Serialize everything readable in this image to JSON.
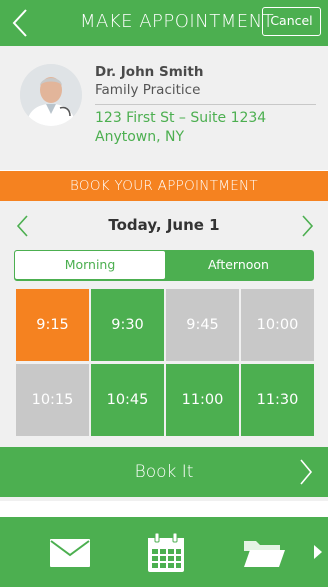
{
  "header": {
    "title": "MAKE APPOINTMENT",
    "cancel_label": "Cancel",
    "back_icon": "chevron-left-icon"
  },
  "doctor": {
    "name": "Dr. John Smith",
    "specialty": "Family Pracitice",
    "address_line1": "123 First St – Suite 1234",
    "address_line2": "Anytown, NY"
  },
  "booking": {
    "banner": "BOOK YOUR APPOINTMENT",
    "date_label": "Today, June 1",
    "segments": {
      "morning": "Morning",
      "afternoon": "Afternoon",
      "selected": "Morning"
    },
    "slots": [
      {
        "time": "9:15",
        "state": "selected"
      },
      {
        "time": "9:30",
        "state": "available"
      },
      {
        "time": "9:45",
        "state": "unavailable"
      },
      {
        "time": "10:00",
        "state": "unavailable"
      },
      {
        "time": "10:15",
        "state": "unavailable"
      },
      {
        "time": "10:45",
        "state": "available"
      },
      {
        "time": "11:00",
        "state": "available"
      },
      {
        "time": "11:30",
        "state": "available"
      }
    ],
    "book_label": "Book It"
  },
  "tabbar": {
    "items": [
      "mail-icon",
      "calendar-icon",
      "folder-icon",
      "more-arrow-icon"
    ],
    "active": "calendar-icon"
  },
  "colors": {
    "green": "#4caf50",
    "orange": "#f58220",
    "gray_slot": "#c8c8c8",
    "panel_bg": "#f0f0f0"
  }
}
